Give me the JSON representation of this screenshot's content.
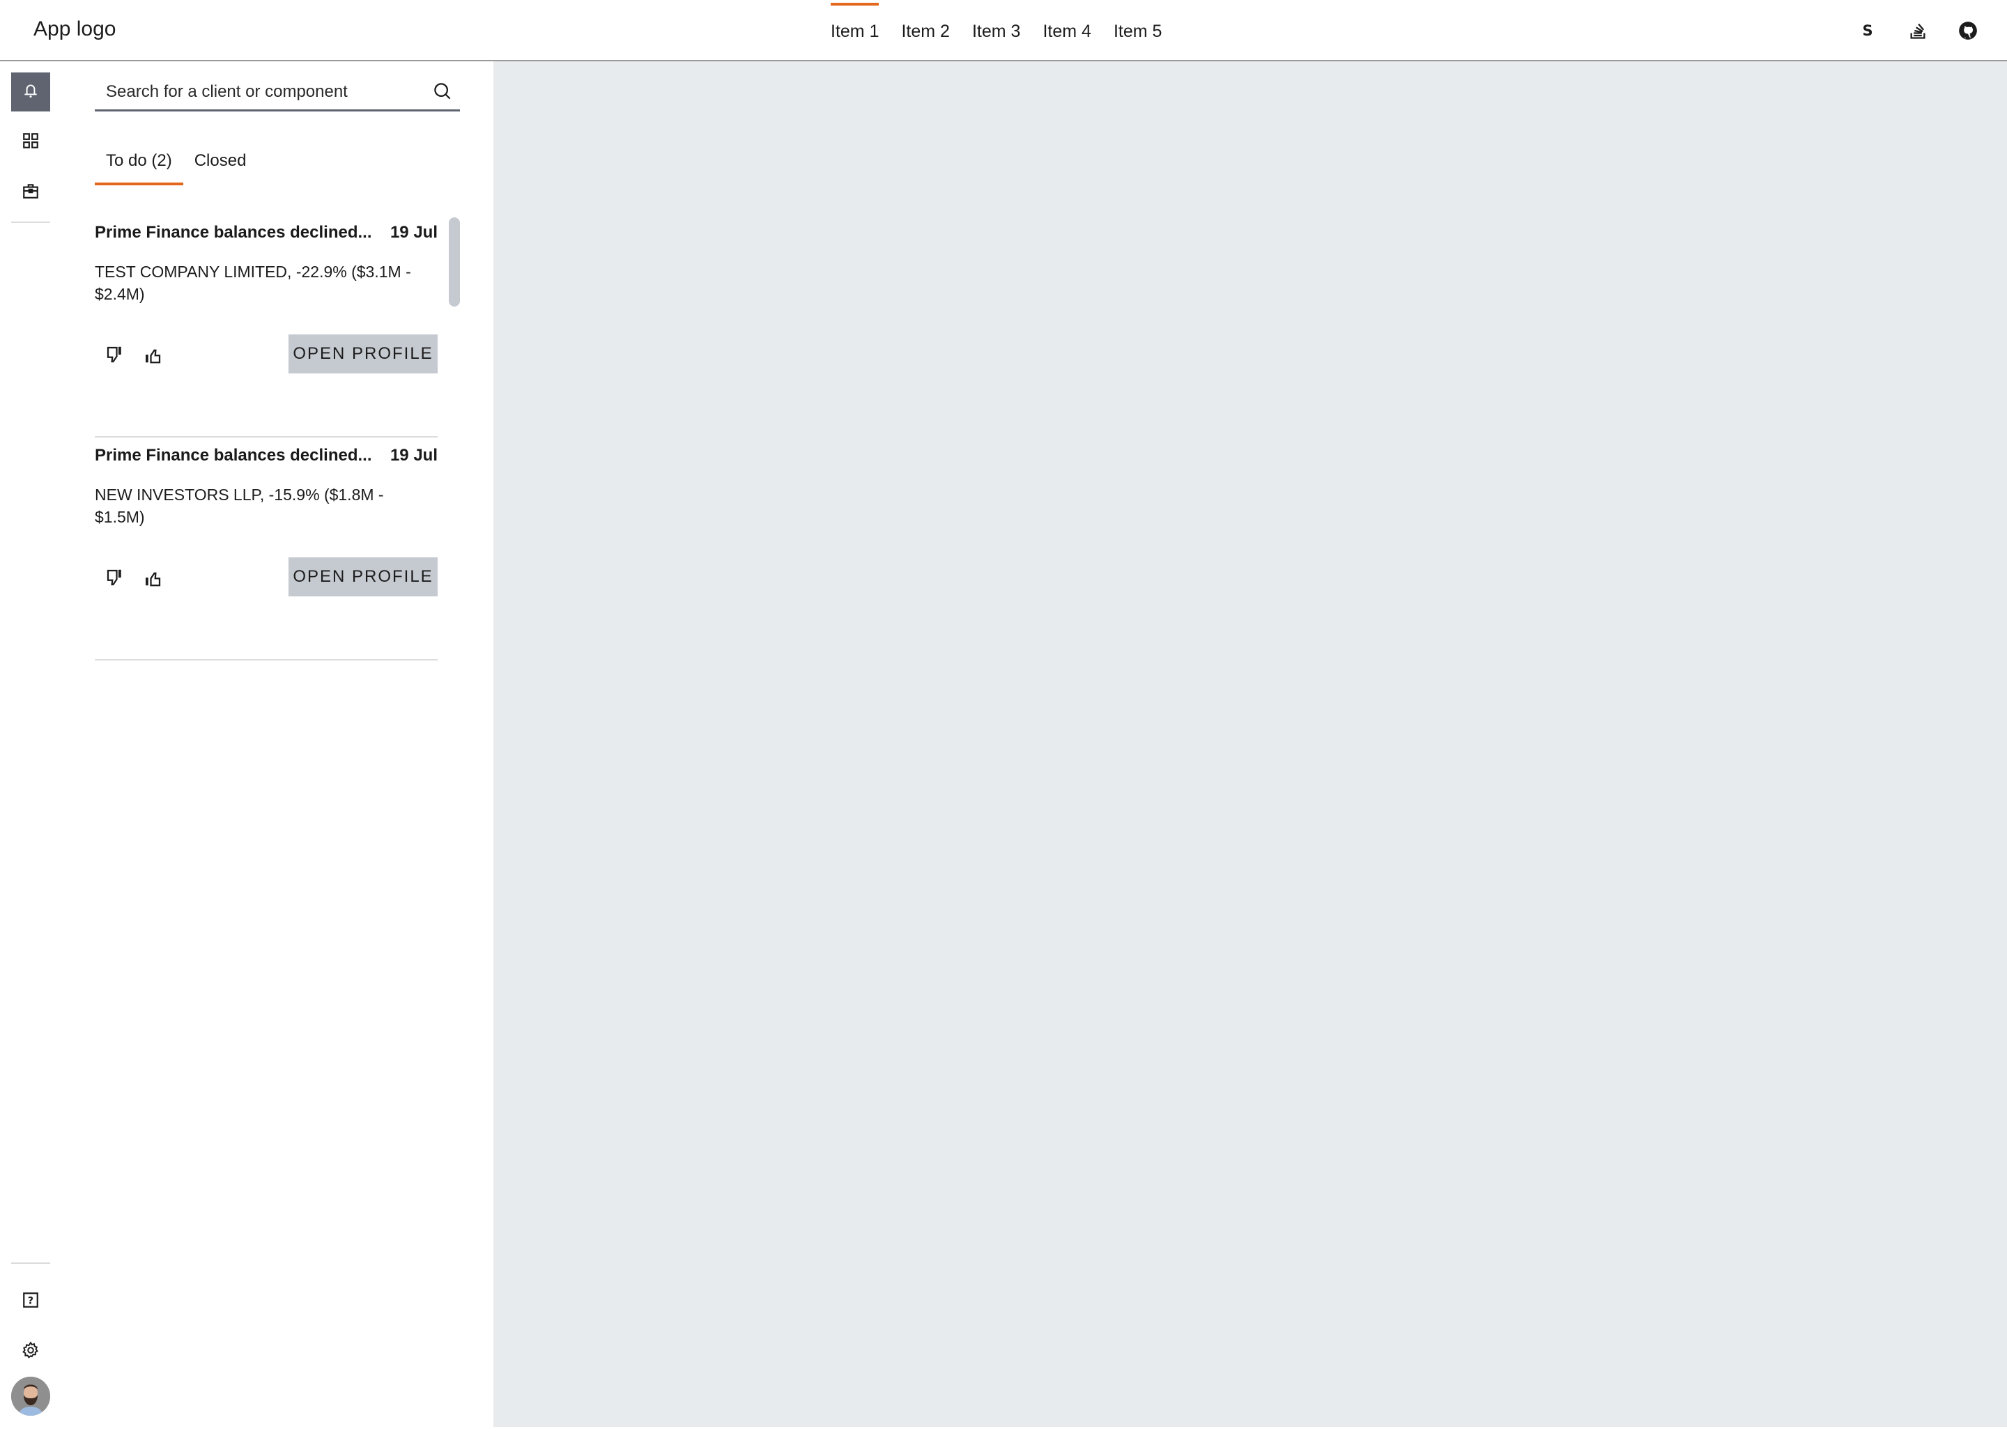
{
  "header": {
    "logo": "App logo",
    "nav": [
      {
        "label": "Item 1",
        "active": true
      },
      {
        "label": "Item 2",
        "active": false
      },
      {
        "label": "Item 3",
        "active": false
      },
      {
        "label": "Item 4",
        "active": false
      },
      {
        "label": "Item 5",
        "active": false
      }
    ],
    "icons": [
      "storybook-icon",
      "stackoverflow-icon",
      "github-icon"
    ]
  },
  "rail": {
    "top_items": [
      {
        "icon": "bell-icon",
        "active": true
      },
      {
        "icon": "grid-icon",
        "active": false
      },
      {
        "icon": "briefcase-icon",
        "active": false
      }
    ],
    "bottom_items": [
      {
        "icon": "help-icon"
      },
      {
        "icon": "gear-icon"
      },
      {
        "icon": "avatar"
      }
    ]
  },
  "panel": {
    "search": {
      "placeholder": "Search for a client or component",
      "value": ""
    },
    "tabs": [
      {
        "label": "To do (2)",
        "active": true
      },
      {
        "label": "Closed",
        "active": false
      }
    ],
    "cards": [
      {
        "title": "Prime Finance balances declined...",
        "date": "19 Jul",
        "body": "TEST COMPANY LIMITED, -22.9% ($3.1M - $2.4M)",
        "button": "OPEN PROFILE"
      },
      {
        "title": "Prime Finance balances declined...",
        "date": "19 Jul",
        "body": "NEW INVESTORS LLP, -15.9% ($1.8M - $1.5M)",
        "button": "OPEN PROFILE"
      }
    ]
  },
  "colors": {
    "accent": "#e3671d",
    "rail_active": "#5f6470",
    "button_bg": "#c5c9d0",
    "main_bg": "#e8ebee"
  }
}
